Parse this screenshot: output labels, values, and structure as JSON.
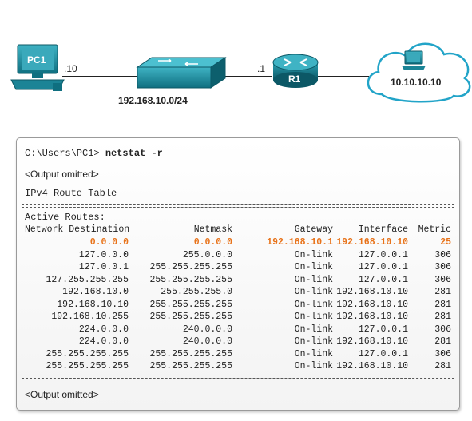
{
  "topology": {
    "pc1_label": "PC1",
    "pc1_host": ".10",
    "network": "192.168.10.0/24",
    "router_port": ".1",
    "router_label": "R1",
    "remote_host": "10.10.10.10",
    "colors": {
      "teal": "#1e8c9e",
      "teal_dark": "#0f5f6e",
      "cloud_border": "#22a4c8"
    }
  },
  "terminal": {
    "prompt": "C:\\Users\\PC1> ",
    "command": "netstat -r",
    "omitted_top": "<Output omitted>",
    "table_title": "IPv4 Route Table",
    "separator": "===========================================================================",
    "active_routes": "Active Routes:",
    "headers": {
      "dest": "Network Destination",
      "mask": "Netmask",
      "gateway": "Gateway",
      "interface": "Interface",
      "metric": "Metric"
    },
    "routes": [
      {
        "dest": "0.0.0.0",
        "mask": "0.0.0.0",
        "gateway": "192.168.10.1",
        "interface": "192.168.10.10",
        "metric": "25",
        "highlight": true
      },
      {
        "dest": "127.0.0.0",
        "mask": "255.0.0.0",
        "gateway": "On-link",
        "interface": "127.0.0.1",
        "metric": "306"
      },
      {
        "dest": "127.0.0.1",
        "mask": "255.255.255.255",
        "gateway": "On-link",
        "interface": "127.0.0.1",
        "metric": "306"
      },
      {
        "dest": "127.255.255.255",
        "mask": "255.255.255.255",
        "gateway": "On-link",
        "interface": "127.0.0.1",
        "metric": "306"
      },
      {
        "dest": "192.168.10.0",
        "mask": "255.255.255.0",
        "gateway": "On-link",
        "interface": "192.168.10.10",
        "metric": "281"
      },
      {
        "dest": "192.168.10.10",
        "mask": "255.255.255.255",
        "gateway": "On-link",
        "interface": "192.168.10.10",
        "metric": "281"
      },
      {
        "dest": "192.168.10.255",
        "mask": "255.255.255.255",
        "gateway": "On-link",
        "interface": "192.168.10.10",
        "metric": "281"
      },
      {
        "dest": "224.0.0.0",
        "mask": "240.0.0.0",
        "gateway": "On-link",
        "interface": "127.0.0.1",
        "metric": "306"
      },
      {
        "dest": "224.0.0.0",
        "mask": "240.0.0.0",
        "gateway": "On-link",
        "interface": "192.168.10.10",
        "metric": "281"
      },
      {
        "dest": "255.255.255.255",
        "mask": "255.255.255.255",
        "gateway": "On-link",
        "interface": "127.0.0.1",
        "metric": "306"
      },
      {
        "dest": "255.255.255.255",
        "mask": "255.255.255.255",
        "gateway": "On-link",
        "interface": "192.168.10.10",
        "metric": "281"
      }
    ],
    "omitted_bottom": "<Output omitted>",
    "highlight_color": "#e8731a"
  }
}
